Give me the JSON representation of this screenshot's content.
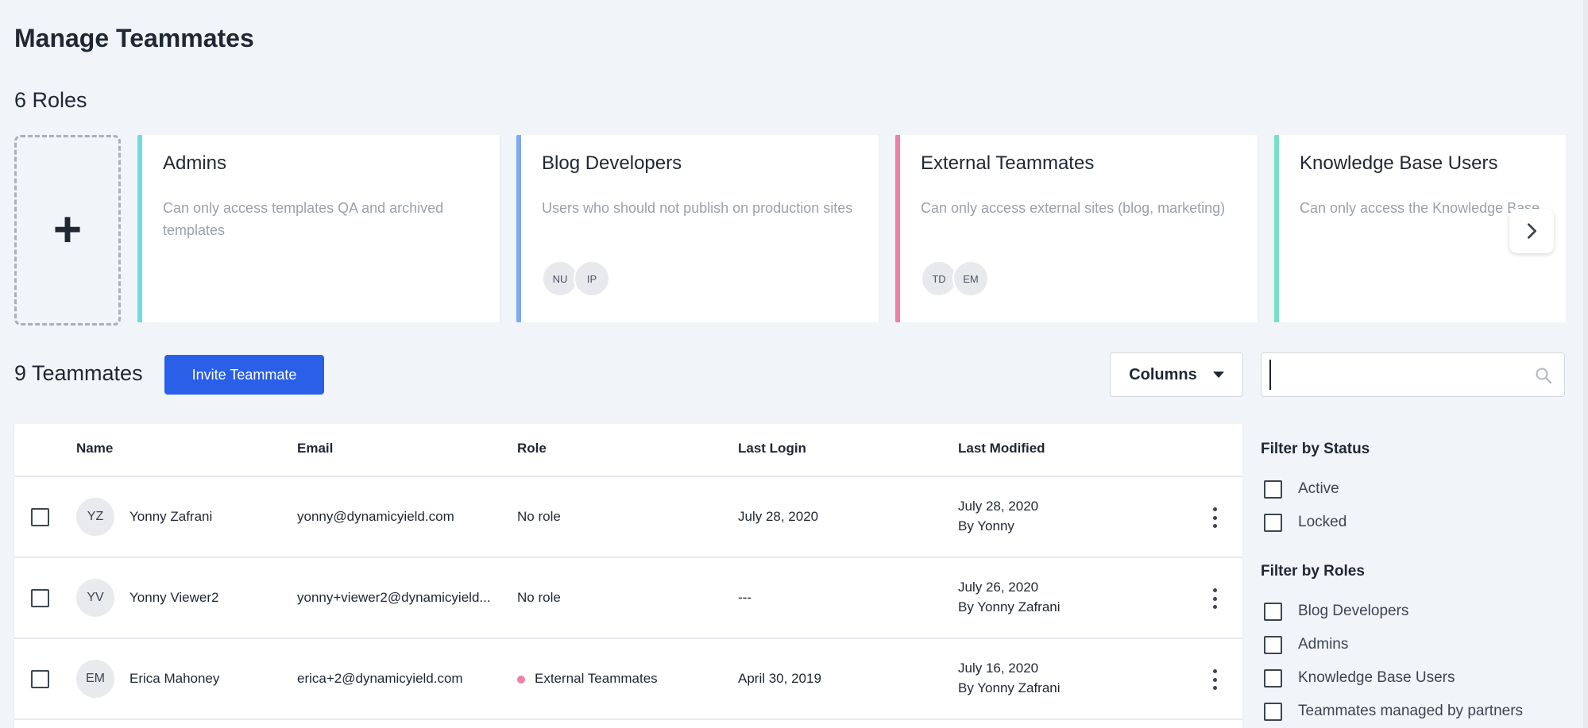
{
  "page": {
    "title": "Manage Teammates"
  },
  "roles": {
    "heading": "6 Roles",
    "add_label": "+",
    "cards": [
      {
        "title": "Admins",
        "description": "Can only access templates QA and archived templates",
        "color": "#6fdbe0",
        "avatars": []
      },
      {
        "title": "Blog Developers",
        "description": "Users who should not publish on production sites",
        "color": "#7eaaf0",
        "avatars": [
          "NU",
          "IP"
        ]
      },
      {
        "title": "External Teammates",
        "description": "Can only access external sites (blog, marketing)",
        "color": "#ef7fa6",
        "avatars": [
          "TD",
          "EM"
        ]
      },
      {
        "title": "Knowledge Base Users",
        "description": "Can only access the Knowledge Base",
        "color": "#78e0c2",
        "avatars": []
      }
    ]
  },
  "teammates": {
    "heading": "9 Teammates",
    "invite_label": "Invite Teammate",
    "columns_label": "Columns",
    "search": {
      "placeholder": "",
      "value": ""
    }
  },
  "table": {
    "headers": [
      "Name",
      "Email",
      "Role",
      "Last Login",
      "Last Modified"
    ],
    "rows": [
      {
        "initials": "YZ",
        "name": "Yonny Zafrani",
        "email": "yonny@dynamicyield.com",
        "role": "No role",
        "role_color": "",
        "last_login": "July 28, 2020",
        "modified_date": "July 28, 2020",
        "modified_by": "By Yonny"
      },
      {
        "initials": "YV",
        "name": "Yonny Viewer2",
        "email": "yonny+viewer2@dynamicyield...",
        "role": "No role",
        "role_color": "",
        "last_login": "---",
        "modified_date": "July 26, 2020",
        "modified_by": "By Yonny Zafrani"
      },
      {
        "initials": "EM",
        "name": "Erica Mahoney",
        "email": "erica+2@dynamicyield.com",
        "role": "External Teammates",
        "role_color": "#ef7fa6",
        "last_login": "April 30, 2019",
        "modified_date": "July 16, 2020",
        "modified_by": "By Yonny Zafrani"
      }
    ]
  },
  "filters": {
    "status": {
      "title": "Filter by Status",
      "options": [
        "Active",
        "Locked"
      ]
    },
    "roles": {
      "title": "Filter by Roles",
      "options": [
        "Blog Developers",
        "Admins",
        "Knowledge Base Users",
        "Teammates managed by partners"
      ]
    }
  }
}
